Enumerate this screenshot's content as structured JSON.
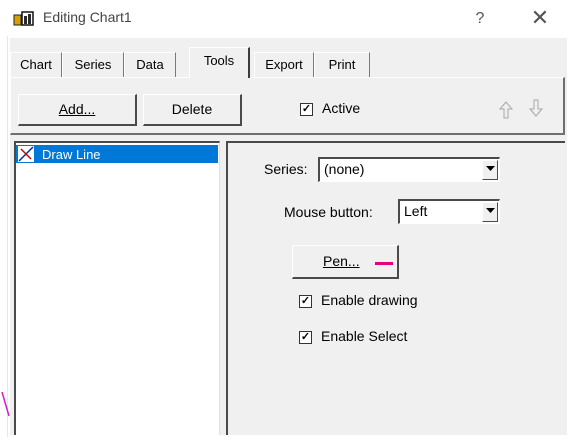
{
  "window": {
    "title": "Editing Chart1",
    "help_glyph": "?",
    "close_glyph": "✕"
  },
  "tabs": [
    {
      "label": "Chart",
      "active": false
    },
    {
      "label": "Series",
      "active": false
    },
    {
      "label": "Data",
      "active": false
    },
    {
      "label": "Tools",
      "active": true
    },
    {
      "label": "Export",
      "active": false
    },
    {
      "label": "Print",
      "active": false
    }
  ],
  "toolbar": {
    "add_label": "Add...",
    "delete_label": "Delete",
    "active_label": "Active",
    "active_checked": true,
    "move_up_icon": "arrow-up-icon",
    "move_down_icon": "arrow-down-icon"
  },
  "tool_list": {
    "items": [
      {
        "label": "Draw Line",
        "icon": "draw-line-icon",
        "selected": true
      }
    ]
  },
  "settings": {
    "series_label": "Series:",
    "series_value": "(none)",
    "mouse_button_label": "Mouse button:",
    "mouse_button_value": "Left",
    "pen_label": "Pen...",
    "pen_color": "#e6007e",
    "enable_drawing_label": "Enable drawing",
    "enable_drawing_checked": true,
    "enable_select_label": "Enable Select",
    "enable_select_checked": true
  },
  "colors": {
    "selection": "#0078d7",
    "dialog_bg": "#f0f0f0",
    "pen": "#e6007e"
  }
}
